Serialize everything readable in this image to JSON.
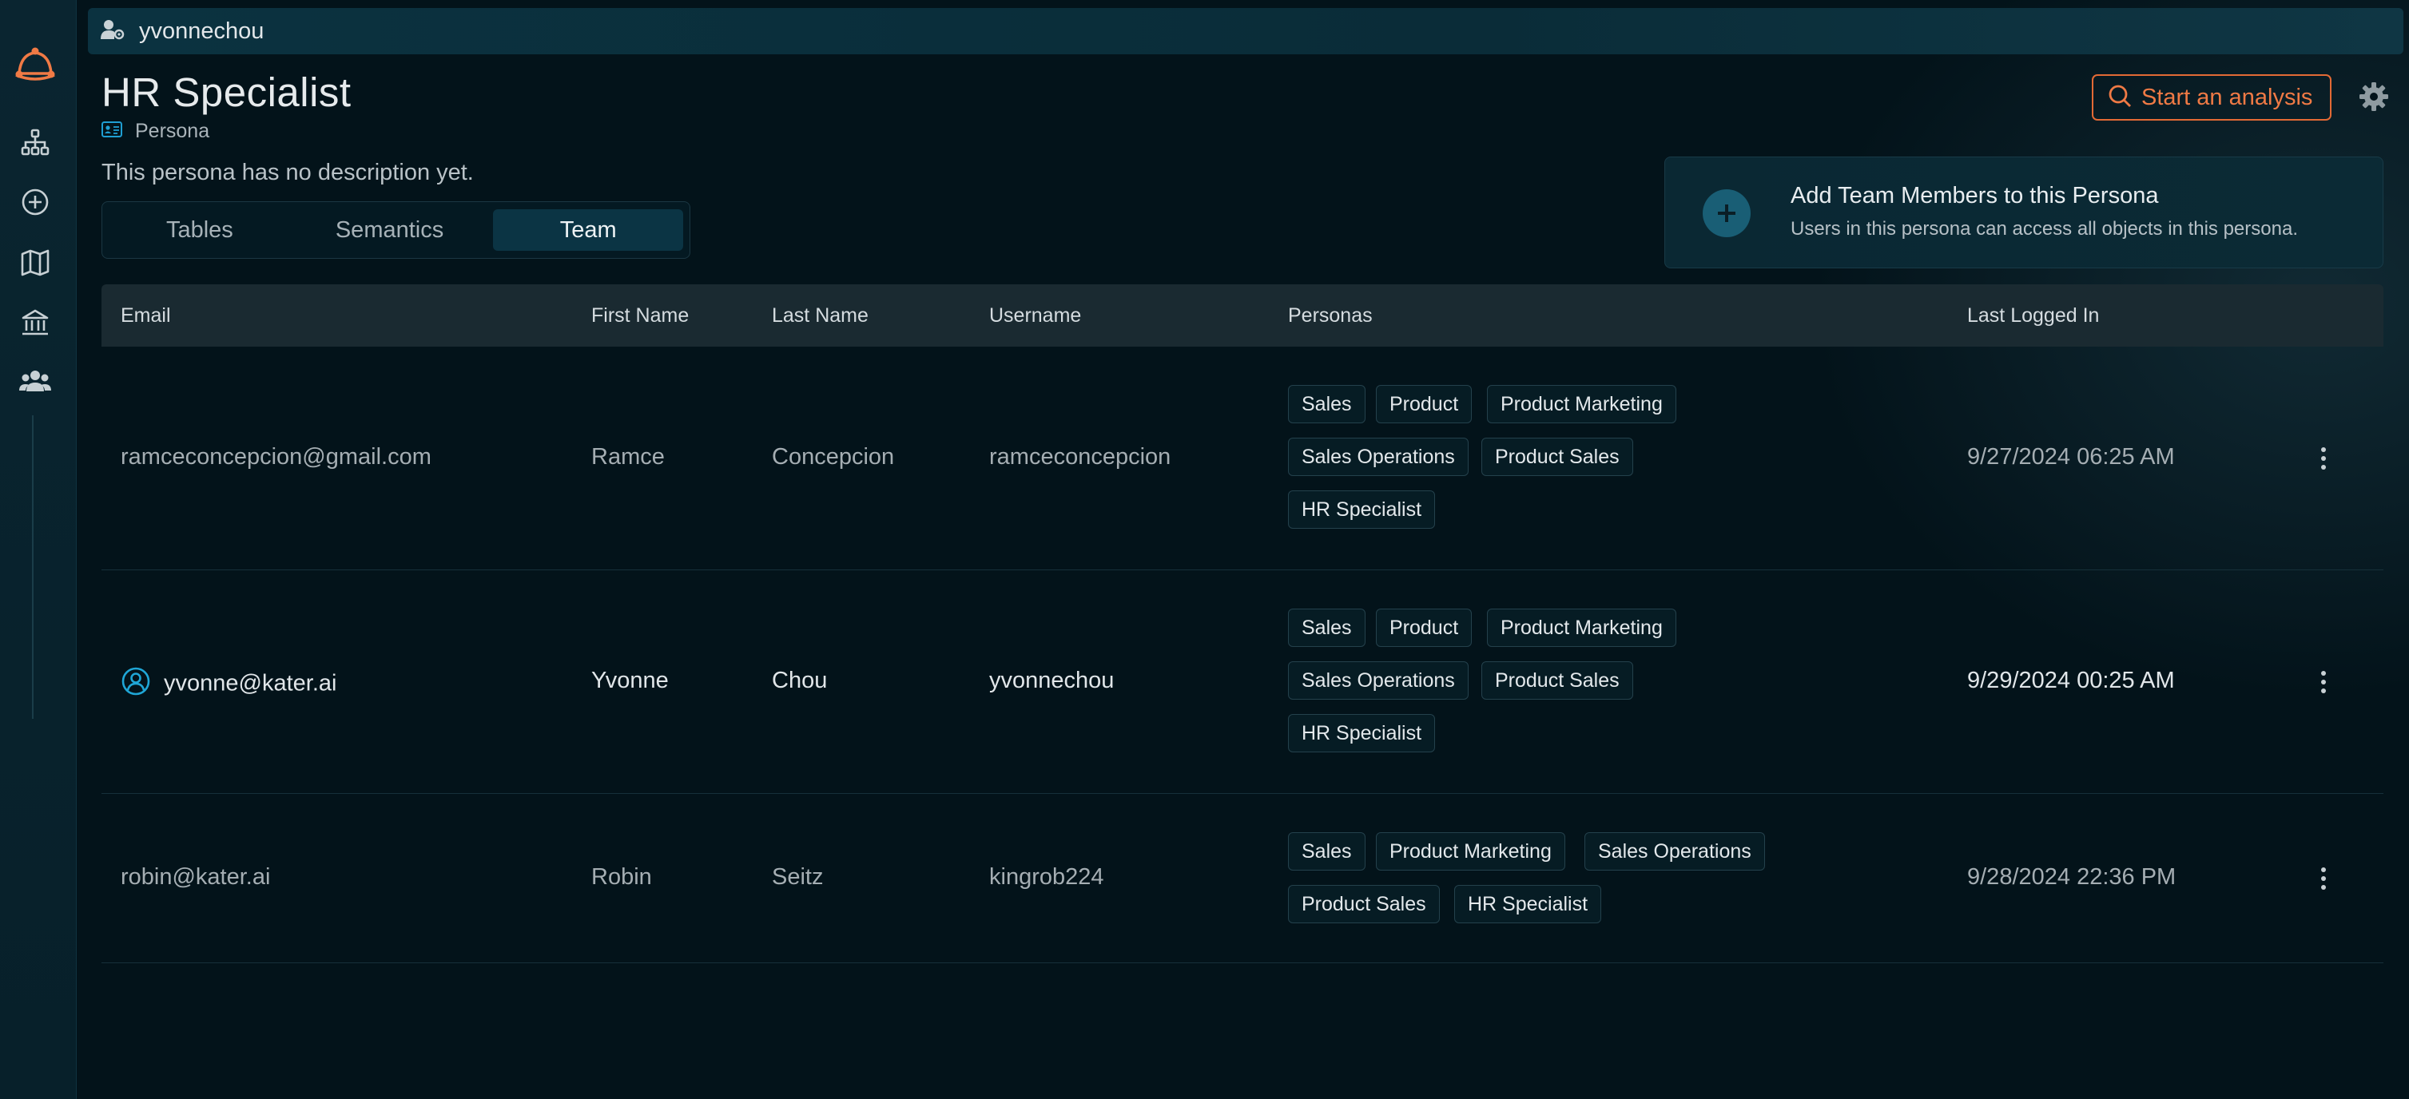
{
  "topbar": {
    "username": "yvonnechou",
    "user_icon": "user-gear-icon"
  },
  "sidebar": {
    "logo": "kater-logo",
    "items": [
      {
        "icon": "hierarchy-icon"
      },
      {
        "icon": "plus-circle-icon"
      },
      {
        "icon": "map-icon"
      },
      {
        "icon": "bank-icon"
      },
      {
        "icon": "users-icon"
      }
    ]
  },
  "header": {
    "title": "HR Specialist",
    "type_label": "Persona",
    "description": "This persona has no description yet."
  },
  "tabs": [
    "Tables",
    "Semantics",
    "Team"
  ],
  "active_tab": "Team",
  "actions": {
    "start_analysis": "Start an analysis"
  },
  "add_card": {
    "title": "Add Team Members to this Persona",
    "subtitle": "Users in this persona can access all objects in this persona."
  },
  "table": {
    "columns": [
      "Email",
      "First Name",
      "Last Name",
      "Username",
      "Personas",
      "Last Logged In"
    ],
    "rows": [
      {
        "email": "ramceconcepcion@gmail.com",
        "first_name": "Ramce",
        "last_name": "Concepcion",
        "username": "ramceconcepcion",
        "personas": [
          "Sales",
          "Product",
          "Product Marketing",
          "Sales Operations",
          "Product Sales",
          "HR Specialist"
        ],
        "last_logged_in": "9/27/2024 06:25 AM",
        "current_user": false
      },
      {
        "email": "yvonne@kater.ai",
        "first_name": "Yvonne",
        "last_name": "Chou",
        "username": "yvonnechou",
        "personas": [
          "Sales",
          "Product",
          "Product Marketing",
          "Sales Operations",
          "Product Sales",
          "HR Specialist"
        ],
        "last_logged_in": "9/29/2024 00:25 AM",
        "current_user": true
      },
      {
        "email": "robin@kater.ai",
        "first_name": "Robin",
        "last_name": "Seitz",
        "username": "kingrob224",
        "personas": [
          "Sales",
          "Product Marketing",
          "Sales Operations",
          "Product Sales",
          "HR Specialist"
        ],
        "last_logged_in": "9/28/2024 22:36 PM",
        "current_user": false
      }
    ]
  },
  "colors": {
    "accent": "#f07a45",
    "background": "#03131a",
    "active_tab": "#0b3444",
    "current_user_icon": "#1fa6d6"
  }
}
